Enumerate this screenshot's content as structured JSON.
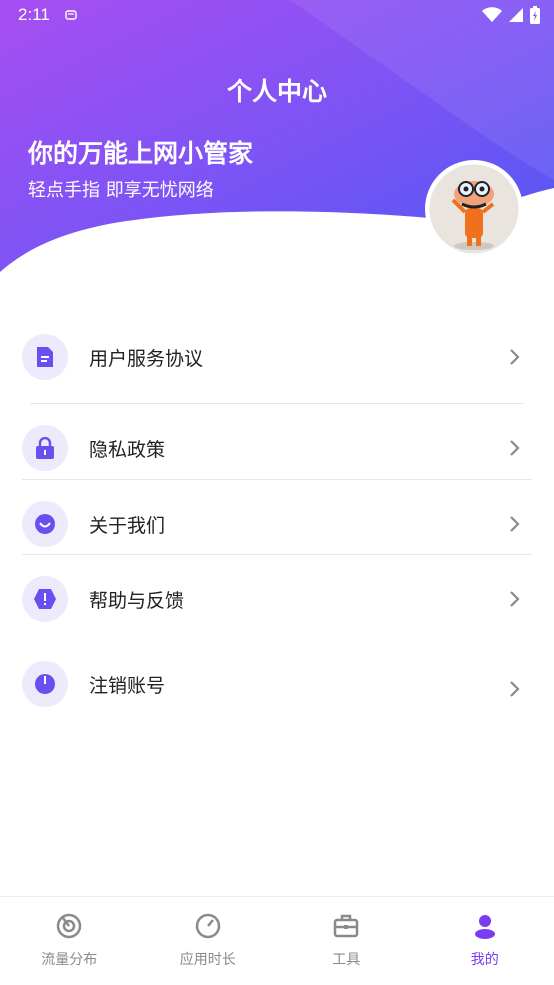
{
  "status_bar": {
    "time": "2:11"
  },
  "header": {
    "title": "个人中心",
    "slogan": "你的万能上网小管家",
    "subslogan": "轻点手指 即享无忧网络"
  },
  "menu": [
    {
      "label": "用户服务协议",
      "icon": "document-icon"
    },
    {
      "label": "隐私政策",
      "icon": "lock-icon"
    },
    {
      "label": "关于我们",
      "icon": "smile-icon"
    },
    {
      "label": "帮助与反馈",
      "icon": "alert-icon"
    },
    {
      "label": "注销账号",
      "icon": "power-icon"
    }
  ],
  "tabs": [
    {
      "label": "流量分布",
      "icon": "radar-icon",
      "active": false
    },
    {
      "label": "应用时长",
      "icon": "gauge-icon",
      "active": false
    },
    {
      "label": "工具",
      "icon": "toolbox-icon",
      "active": false
    },
    {
      "label": "我的",
      "icon": "person-icon",
      "active": true
    }
  ],
  "colors": {
    "gradient_start": "#a44ff2",
    "gradient_end": "#5d55f4",
    "accent": "#7a3cf0"
  }
}
